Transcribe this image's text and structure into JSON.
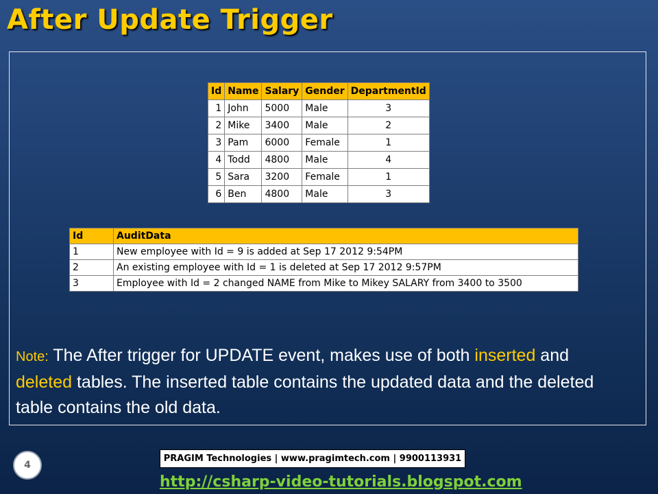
{
  "slide": {
    "title": "After Update Trigger",
    "page_number": "4"
  },
  "employee_table": {
    "headers": [
      "Id",
      "Name",
      "Salary",
      "Gender",
      "DepartmentId"
    ],
    "rows": [
      [
        "1",
        "John",
        "5000",
        "Male",
        "3"
      ],
      [
        "2",
        "Mike",
        "3400",
        "Male",
        "2"
      ],
      [
        "3",
        "Pam",
        "6000",
        "Female",
        "1"
      ],
      [
        "4",
        "Todd",
        "4800",
        "Male",
        "4"
      ],
      [
        "5",
        "Sara",
        "3200",
        "Female",
        "1"
      ],
      [
        "6",
        "Ben",
        "4800",
        "Male",
        "3"
      ]
    ]
  },
  "audit_table": {
    "headers": [
      "Id",
      "AuditData"
    ],
    "rows": [
      [
        "1",
        "New employee with Id  = 9 is added at Sep 17 2012  9:54PM"
      ],
      [
        "2",
        "An existing employee with Id  = 1 is deleted at Sep 17 2012  9:57PM"
      ],
      [
        "3",
        "Employee with Id = 2 changed NAME from Mike to Mikey SALARY from 3400 to 3500"
      ]
    ]
  },
  "note": {
    "label": "Note:",
    "part1": " The After trigger for UPDATE event, makes use of both ",
    "inserted": "inserted",
    "part2": " and ",
    "deleted": "deleted",
    "part3": " tables. The inserted table contains the updated data and the deleted table contains the old data."
  },
  "footer": {
    "company": "PRAGIM Technologies | www.pragimtech.com | 9900113931",
    "link": "http://csharp-video-tutorials.blogspot.com"
  },
  "colors": {
    "title": "#ffcc00",
    "header_fill": "#ffc000",
    "link": "#7fd13b"
  }
}
